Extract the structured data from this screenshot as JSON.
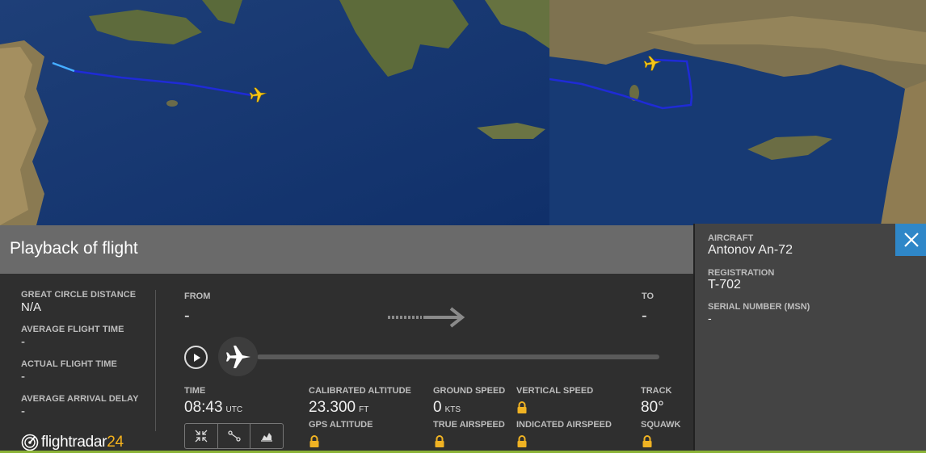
{
  "panel": {
    "title": "Playback of flight"
  },
  "stats": [
    {
      "label": "GREAT CIRCLE DISTANCE",
      "value": "N/A"
    },
    {
      "label": "AVERAGE FLIGHT TIME",
      "value": "-"
    },
    {
      "label": "ACTUAL FLIGHT TIME",
      "value": "-"
    },
    {
      "label": "AVERAGE ARRIVAL DELAY",
      "value": "-"
    }
  ],
  "route": {
    "from_label": "FROM",
    "from_value": "-",
    "to_label": "TO",
    "to_value": "-"
  },
  "telemetry": {
    "time_label": "TIME",
    "time_value": "08:43",
    "time_unit": "UTC",
    "cal_alt_label": "CALIBRATED ALTITUDE",
    "cal_alt_value": "23.300",
    "cal_alt_unit": "FT",
    "gps_alt_label": "GPS ALTITUDE",
    "ground_speed_label": "GROUND SPEED",
    "ground_speed_value": "0",
    "ground_speed_unit": "KTS",
    "true_airspeed_label": "TRUE AIRSPEED",
    "vertical_speed_label": "VERTICAL SPEED",
    "indicated_airspeed_label": "INDICATED AIRSPEED",
    "track_label": "TRACK",
    "track_value": "80°",
    "squawk_label": "SQUAWK"
  },
  "aircraft": {
    "aircraft_label": "AIRCRAFT",
    "aircraft_value": "Antonov An-72",
    "registration_label": "REGISTRATION",
    "registration_value": "T-702",
    "serial_label": "SERIAL NUMBER (MSN)",
    "serial_value": "-"
  },
  "logo": {
    "text": "flightradar",
    "number": "24"
  },
  "icons": {
    "play": "play-icon",
    "plane": "plane-icon",
    "close": "close-icon",
    "lock": "lock-icon",
    "collapse": "collapse-icon",
    "route": "route-icon",
    "graph": "graph-icon"
  },
  "colors": {
    "accent_blue": "#2f87c8",
    "flight_path": "#1f2bd6",
    "plane_yellow": "#f5c518",
    "lock_yellow": "#f0b323",
    "logo_orange": "#f5b21c"
  }
}
